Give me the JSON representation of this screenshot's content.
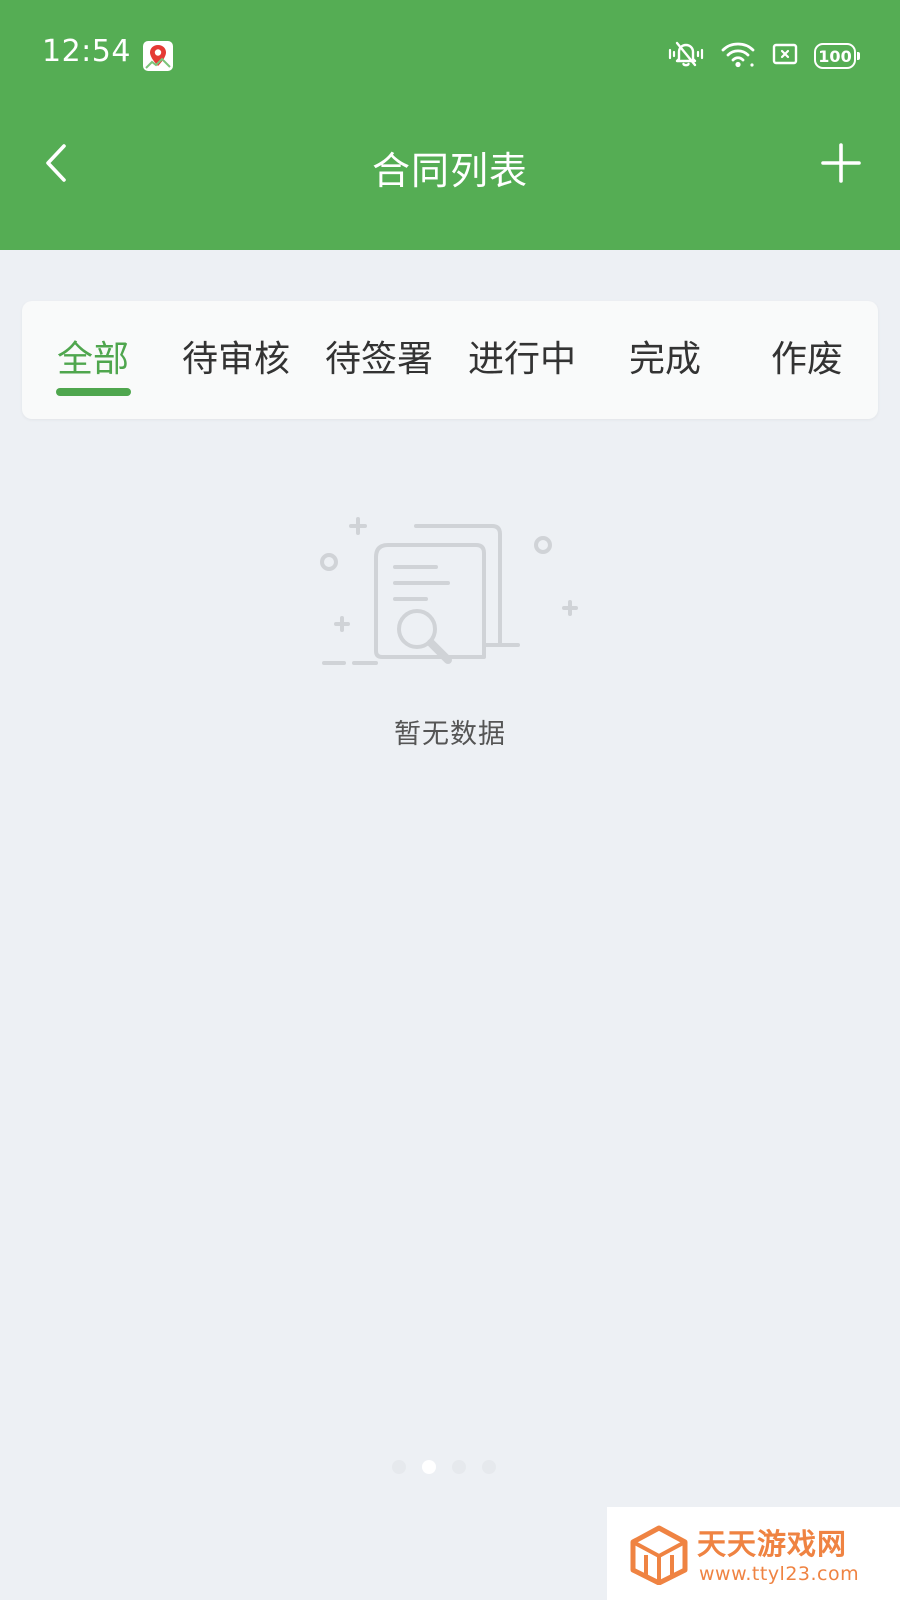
{
  "status_bar": {
    "time": "12:54",
    "battery": "100",
    "icons": [
      "app-notification-icon",
      "vibrate-mute-icon",
      "wifi-icon",
      "sim-icon",
      "battery-icon"
    ]
  },
  "nav": {
    "title": "合同列表",
    "back_icon": "chevron-left-icon",
    "add_icon": "plus-icon"
  },
  "tabs": [
    {
      "label": "全部",
      "active": true
    },
    {
      "label": "待审核",
      "active": false
    },
    {
      "label": "待签署",
      "active": false
    },
    {
      "label": "进行中",
      "active": false
    },
    {
      "label": "完成",
      "active": false
    },
    {
      "label": "作废",
      "active": false
    }
  ],
  "empty_state": {
    "icon": "empty-document-search-icon",
    "text": "暂无数据"
  },
  "pager": {
    "count": 4,
    "active_index": 1
  },
  "watermark": {
    "name": "天天游戏网",
    "url": "www.ttyl23.com"
  },
  "colors": {
    "header_bg": "#55ad54",
    "accent": "#4fa64e",
    "page_bg": "#edf0f4",
    "watermark": "#ef8342"
  }
}
